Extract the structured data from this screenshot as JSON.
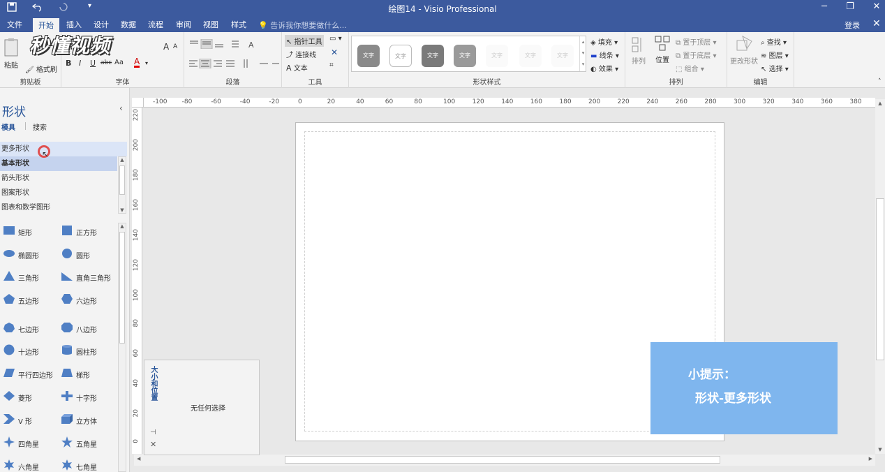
{
  "window": {
    "title": "绘图14 - Visio Professional",
    "qa_icons": [
      "save-icon",
      "undo-icon",
      "redo-icon",
      "customize-icon"
    ],
    "controls": [
      "minimize-icon",
      "restore-icon",
      "close-icon"
    ]
  },
  "menu": {
    "tabs": [
      "文件",
      "开始",
      "插入",
      "设计",
      "数据",
      "流程",
      "审阅",
      "视图",
      "样式"
    ],
    "active_tab": "开始",
    "tell_me": "告诉我你想要做什么...",
    "login": "登录"
  },
  "watermark": "秒懂视频",
  "ribbon": {
    "clipboard": {
      "label": "剪贴板",
      "paste": "粘贴",
      "format_painter": "格式刷"
    },
    "font": {
      "label": "字体",
      "bold": "B",
      "italic": "I",
      "underline": "U",
      "strike": "abc",
      "case": "Aa",
      "color_letter": "A",
      "grow": "A",
      "shrink": "A"
    },
    "paragraph": {
      "label": "段落"
    },
    "tools": {
      "label": "工具",
      "pointer": "指针工具",
      "connector": "连接线",
      "text": "文本",
      "text_letter": "A"
    },
    "shape_styles": {
      "label": "形状样式",
      "swatches": [
        "文字",
        "文字",
        "文字",
        "文字",
        "文字",
        "文字",
        "文字"
      ]
    },
    "fill": "填充",
    "line": "线条",
    "effect": "效果",
    "arrange": {
      "label": "排列",
      "arrange_btn": "排列",
      "position": "位置",
      "bring_front": "置于顶层",
      "send_back": "置于底层",
      "group": "组合"
    },
    "edit": {
      "label": "编辑",
      "change_shape": "更改形状",
      "find": "查找",
      "layers": "图层",
      "select": "选择"
    }
  },
  "shapes_panel": {
    "title": "形状",
    "tabs": [
      "模具",
      "搜索"
    ],
    "stencils": [
      "更多形状",
      "基本形状",
      "箭头形状",
      "图案形状",
      "图表和数学图形"
    ],
    "items": [
      [
        "矩形",
        "正方形"
      ],
      [
        "椭圆形",
        "圆形"
      ],
      [
        "三角形",
        "直角三角形"
      ],
      [
        "五边形",
        "六边形"
      ],
      [
        "七边形",
        "八边形"
      ],
      [
        "十边形",
        "圆柱形"
      ],
      [
        "平行四边形",
        "梯形"
      ],
      [
        "菱形",
        "十字形"
      ],
      [
        "V 形",
        "立方体"
      ],
      [
        "四角星",
        "五角星"
      ],
      [
        "六角星",
        "七角星"
      ]
    ]
  },
  "ruler": {
    "h": [
      "-100",
      "-80",
      "-60",
      "-40",
      "-20",
      "0",
      "20",
      "40",
      "60",
      "80",
      "100",
      "120",
      "140",
      "160",
      "180",
      "200",
      "220",
      "240",
      "260",
      "280",
      "300",
      "320",
      "340",
      "360",
      "380"
    ],
    "v": [
      "220",
      "200",
      "180",
      "160",
      "140",
      "120",
      "100",
      "80",
      "60",
      "40",
      "20",
      "0"
    ]
  },
  "size_panel": {
    "title": "大小和位置",
    "message": "无任何选择"
  },
  "tip": {
    "line1": "小提示：",
    "line2": "形状-更多形状"
  },
  "colors": {
    "accent": "#3c5a9e",
    "shape_blue": "#4f7fc4",
    "tip_bg": "#7fb6ee"
  }
}
